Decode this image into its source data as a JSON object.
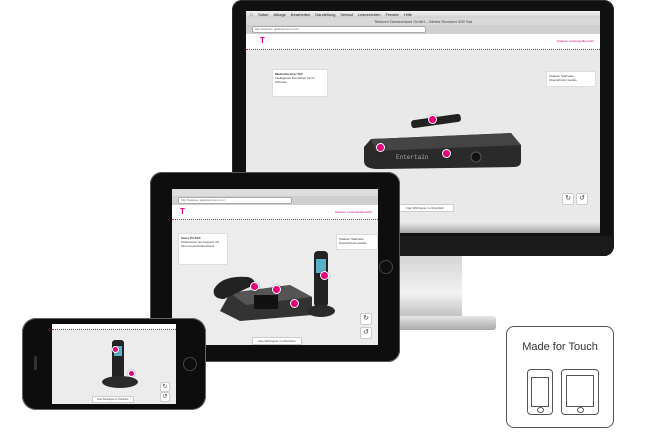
{
  "desktop": {
    "menubar": [
      "Safari",
      "Ablage",
      "Bearbeiten",
      "Darstellung",
      "Verlauf",
      "Lesezeichen",
      "Fenster",
      "Hilfe"
    ],
    "window_title": "Telekom Deutschland GmbH – Media Receiver 500 Sat",
    "url": "http://telekom.geleistemmer.com/",
    "logo": "T",
    "link": "Telekom Leistungsübersicht",
    "info_title": "Media Receiver 500",
    "info_text": "Intelligentes Fernsehen für Ihr Zuhause",
    "side_items": [
      "Telekom Startseite",
      "Übersicht der Geräte"
    ],
    "display_text": "Entertain",
    "start_button": "Das Wichtigste im Überblick"
  },
  "tablet": {
    "url": "http://telekom.geleistemmer.com/",
    "logo": "T",
    "link": "Telekom Leistungsübersicht",
    "info_title": "Sinus PA 302i",
    "info_text": "Telefonieren Sie bequem mit Ihrem Festnetzanschluss.",
    "side_items": [
      "Telekom Startseite",
      "Übersicht der Geräte"
    ],
    "start_button": "Das Wichtigste im Überblick"
  },
  "phone": {
    "start_button": "Das Wichtigste im Überblick"
  },
  "badge": {
    "title": "Made for Touch"
  },
  "colors": {
    "accent": "#e2007a"
  }
}
